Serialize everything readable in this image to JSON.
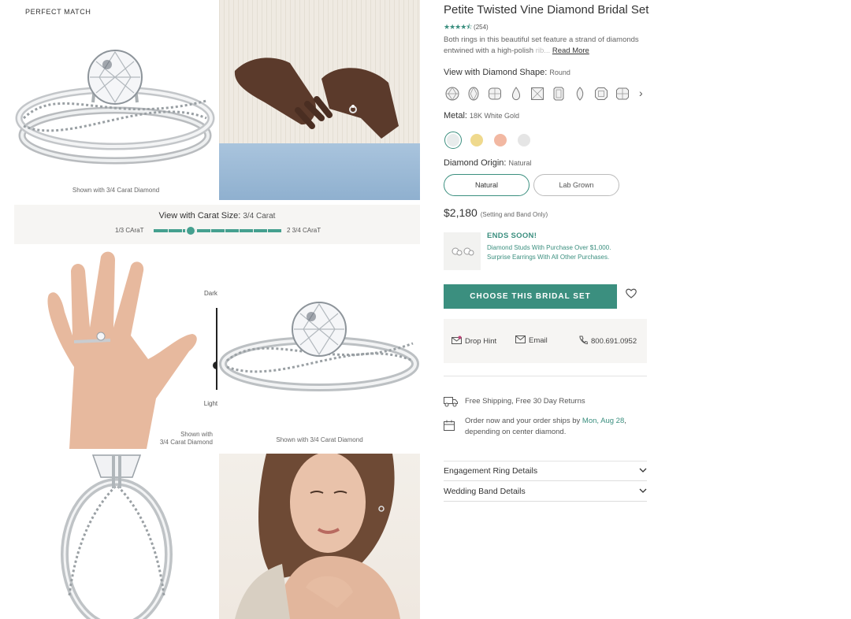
{
  "gallery": {
    "badge": "PERFECT MATCH",
    "caption_top": "Shown with 3/4 Carat Diamond",
    "caption_middle": "Shown with 3/4 Carat Diamond",
    "caption_hand": "Shown with\n3/4 Carat Diamond",
    "carat": {
      "title": "View with Carat Size:",
      "value": "3/4 Carat",
      "min_label": "1/3 CAraT",
      "max_label": "2 3/4 CAraT",
      "position_fraction": 0.29
    },
    "skin_tone": {
      "top_label": "Darker",
      "bottom_label": "Lighter",
      "level_fraction": 0.7
    }
  },
  "product": {
    "title": "Petite Twisted Vine Diamond Bridal Set",
    "rating_stars": 4.5,
    "review_count": "(254)",
    "description": "Both rings in this beautiful set feature a strand of diamonds entwined with a high-polish ",
    "description_fade": "rib...",
    "read_more": "Read More",
    "shape_label": "View with Diamond Shape:",
    "shape_value": "Round",
    "shapes": [
      "round-icon",
      "oval-icon",
      "cushion-icon",
      "pear-icon",
      "princess-icon",
      "emerald-icon",
      "marquise-icon",
      "asscher-icon",
      "radiant-icon"
    ],
    "metal_label": "Metal:",
    "metal_value": "18K White Gold",
    "metals": [
      {
        "name": "18K White Gold",
        "color": "#e8ecec",
        "selected": true
      },
      {
        "name": "18K Yellow Gold",
        "color": "#efd98d",
        "selected": false
      },
      {
        "name": "14K Rose Gold",
        "color": "#f2b8a2",
        "selected": false
      },
      {
        "name": "Platinum",
        "color": "#e5e5e5",
        "selected": false
      }
    ],
    "origin_label": "Diamond Origin:",
    "origin_value": "Natural",
    "origin_options": [
      "Natural",
      "Lab Grown"
    ],
    "price": "$2,180",
    "price_note": "(Setting and Band Only)",
    "promo": {
      "title": "ENDS SOON!",
      "text": "Diamond Studs With Purchase Over $1,000. Surprise Earrings With All Other Purchases."
    },
    "cta": "CHOOSE THIS BRIDAL SET",
    "contact": {
      "hint": "Drop Hint",
      "email": "Email",
      "phone": "800.691.0952"
    },
    "shipping": "Free Shipping, Free 30 Day Returns",
    "order_prefix": "Order now and your order ships by ",
    "order_date": "Mon, Aug 28",
    "order_suffix": ", depending on center diamond.",
    "accordions": [
      "Engagement Ring Details",
      "Wedding Band Details"
    ]
  },
  "colors": {
    "accent": "#3b8f7f",
    "panel_bg": "#f6f5f3"
  }
}
